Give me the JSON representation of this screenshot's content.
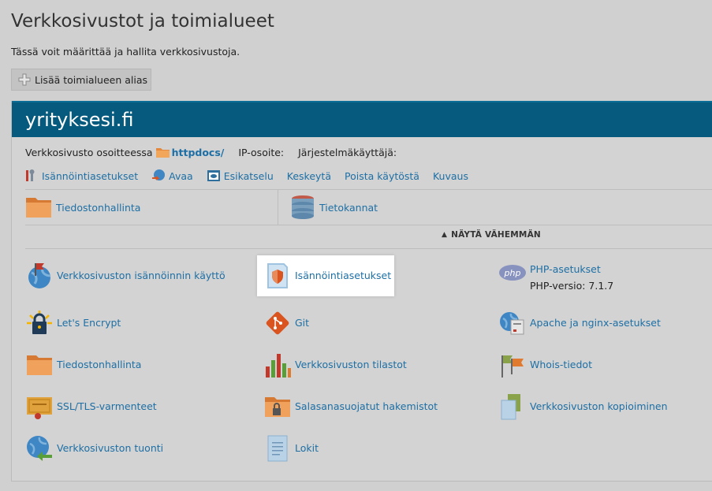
{
  "page": {
    "title": "Verkkosivustot ja toimialueet",
    "description": "Tässä voit määrittää ja hallita verkkosivustoja.",
    "add_alias_button": "Lisää toimialueen alias"
  },
  "site": {
    "domain": "yrityksesi.fi",
    "info": {
      "site_at_label": "Verkkosivusto osoitteessa",
      "docroot": "httpdocs/",
      "ip_label": "IP-osoite:",
      "user_label": "Järjestelmäkäyttäjä:"
    },
    "actions": [
      {
        "label": "Isännöintiasetukset",
        "icon": "wrench-icon"
      },
      {
        "label": "Avaa",
        "icon": "open-globe-icon"
      },
      {
        "label": "Esikatselu",
        "icon": "preview-eye-icon"
      },
      {
        "label": "Keskeytä"
      },
      {
        "label": "Poista käytöstä"
      },
      {
        "label": "Kuvaus"
      }
    ],
    "quick": [
      {
        "label": "Tiedostonhallinta",
        "icon": "folder-icon"
      },
      {
        "label": "Tietokannat",
        "icon": "database-icon"
      }
    ],
    "toggle_label": "NÄYTÄ VÄHEMMÄN",
    "tools": [
      {
        "label": "Verkkosivuston isännöinnin käyttö",
        "icon": "globe-flag-icon"
      },
      {
        "label": "Isännöintiasetukset",
        "icon": "hosting-shield-icon",
        "highlighted": true
      },
      {
        "label": "PHP-asetukset",
        "icon": "php-icon",
        "sub": "PHP-versio: 7.1.7"
      },
      {
        "label": "Let's Encrypt",
        "icon": "lets-encrypt-lock-icon"
      },
      {
        "label": "Git",
        "icon": "git-icon"
      },
      {
        "label": "Apache ja nginx-asetukset",
        "icon": "server-globe-icon"
      },
      {
        "label": "Tiedostonhallinta",
        "icon": "folder-icon"
      },
      {
        "label": "Verkkosivuston tilastot",
        "icon": "stats-bars-icon"
      },
      {
        "label": "Whois-tiedot",
        "icon": "whois-flags-icon"
      },
      {
        "label": "SSL/TLS-varmenteet",
        "icon": "certificate-icon"
      },
      {
        "label": "Salasanasuojatut hakemistot",
        "icon": "locked-folder-icon"
      },
      {
        "label": "Verkkosivuston kopioiminen",
        "icon": "copy-docs-icon"
      },
      {
        "label": "Verkkosivuston tuonti",
        "icon": "import-globe-icon"
      },
      {
        "label": "Lokit",
        "icon": "log-doc-icon"
      }
    ]
  },
  "colors": {
    "header_bg": "#055a7e",
    "link": "#1d6fa5",
    "page_bg": "#d0d0d0"
  }
}
